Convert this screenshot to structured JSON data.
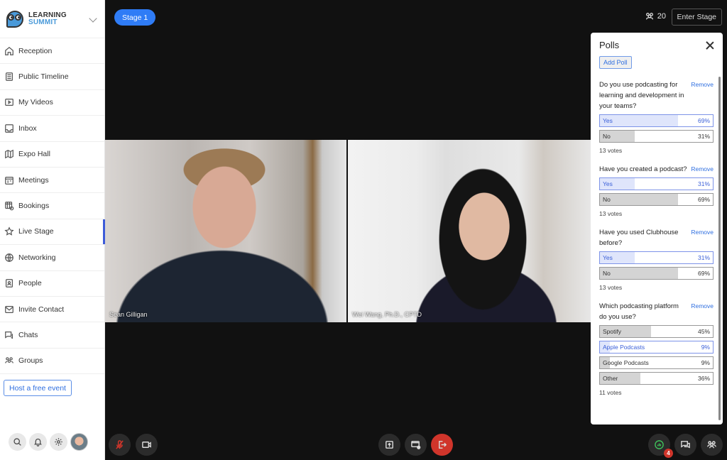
{
  "brand": {
    "line1": "LEARNING",
    "line2": "SUMMIT"
  },
  "sidebar": {
    "items": [
      {
        "label": "Reception",
        "icon": "home-icon"
      },
      {
        "label": "Public Timeline",
        "icon": "document-icon"
      },
      {
        "label": "My Videos",
        "icon": "video-play-icon"
      },
      {
        "label": "Inbox",
        "icon": "inbox-icon"
      },
      {
        "label": "Expo Hall",
        "icon": "map-icon"
      },
      {
        "label": "Meetings",
        "icon": "calendar-icon"
      },
      {
        "label": "Bookings",
        "icon": "calendar-clock-icon"
      },
      {
        "label": "Live Stage",
        "icon": "star-icon",
        "active": true
      },
      {
        "label": "Networking",
        "icon": "globe-icon"
      },
      {
        "label": "People",
        "icon": "person-badge-icon"
      },
      {
        "label": "Invite Contact",
        "icon": "envelope-icon"
      },
      {
        "label": "Chats",
        "icon": "chat-icon"
      },
      {
        "label": "Groups",
        "icon": "group-icon"
      }
    ],
    "host_button": "Host a free event"
  },
  "stage": {
    "pill": "Stage 1",
    "attendee_count": "20",
    "enter_button": "Enter Stage",
    "videos": [
      {
        "name": "Sean Gilligan"
      },
      {
        "name": "Wei Wang, Ph.D., CPTD"
      }
    ],
    "badge_count": "4"
  },
  "polls": {
    "title": "Polls",
    "add_label": "Add Poll",
    "remove_label": "Remove",
    "items": [
      {
        "question": "Do you use podcasting for learning and development in your teams?",
        "options": [
          {
            "label": "Yes",
            "percent": "69%",
            "value": 69,
            "selected": true
          },
          {
            "label": "No",
            "percent": "31%",
            "value": 31,
            "selected": false
          }
        ],
        "votes": "13 votes"
      },
      {
        "question": "Have you created a podcast?",
        "options": [
          {
            "label": "Yes",
            "percent": "31%",
            "value": 31,
            "selected": true
          },
          {
            "label": "No",
            "percent": "69%",
            "value": 69,
            "selected": false
          }
        ],
        "votes": "13 votes"
      },
      {
        "question": "Have you used Clubhouse before?",
        "options": [
          {
            "label": "Yes",
            "percent": "31%",
            "value": 31,
            "selected": true
          },
          {
            "label": "No",
            "percent": "69%",
            "value": 69,
            "selected": false
          }
        ],
        "votes": "13 votes"
      },
      {
        "question": "Which podcasting platform do you use?",
        "options": [
          {
            "label": "Spotify",
            "percent": "45%",
            "value": 45,
            "selected": false
          },
          {
            "label": "Apple Podcasts",
            "percent": "9%",
            "value": 9,
            "selected": true
          },
          {
            "label": "Google Podcasts",
            "percent": "9%",
            "value": 9,
            "selected": false
          },
          {
            "label": "Other",
            "percent": "36%",
            "value": 36,
            "selected": false
          }
        ],
        "votes": "11 votes"
      }
    ]
  },
  "colors": {
    "accent": "#2f7cf6",
    "active_indicator": "#3d5bd9",
    "danger": "#d0352b",
    "poll_selected": "#dfe5fb",
    "poll_fill": "#d4d4d4"
  }
}
